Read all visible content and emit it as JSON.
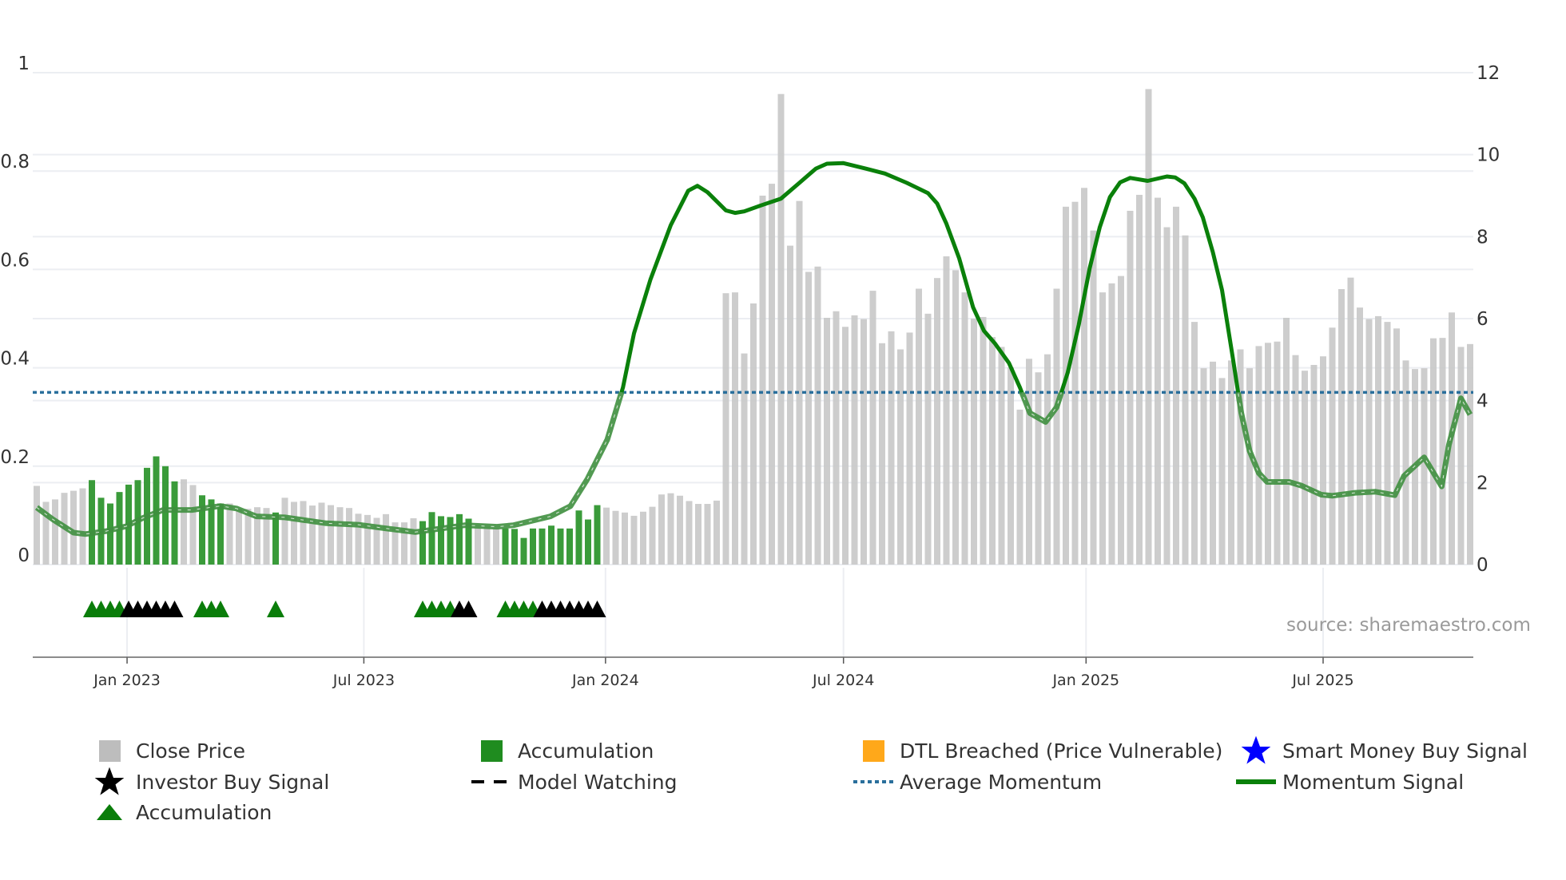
{
  "chart_data": {
    "type": "bar",
    "x_unit": "week index",
    "x_ticks": [
      {
        "label": "Jan 2023",
        "x": 9.83
      },
      {
        "label": "Jul 2023",
        "x": 35.6
      },
      {
        "label": "Jan 2024",
        "x": 61.9
      },
      {
        "label": "Jul 2024",
        "x": 87.8
      },
      {
        "label": "Jan 2025",
        "x": 114.2
      },
      {
        "label": "Jul 2025",
        "x": 140.0
      }
    ],
    "left_axis": {
      "ylim": [
        0,
        1
      ],
      "ticks": [
        "0",
        "0.2",
        "0.4",
        "0.6",
        "0.8",
        "1"
      ],
      "tick_values": [
        0,
        0.2,
        0.4,
        0.6,
        0.8,
        1
      ]
    },
    "right_axis": {
      "ylim": [
        0,
        12
      ],
      "ticks": [
        "0",
        "2",
        "4",
        "6",
        "8",
        "10",
        "12"
      ],
      "tick_values": [
        0,
        2,
        4,
        6,
        8,
        10,
        12
      ]
    },
    "close_price": [
      1.92,
      1.53,
      1.59,
      1.75,
      1.8,
      1.86,
      2.06,
      1.63,
      1.49,
      1.77,
      1.95,
      2.06,
      2.36,
      2.64,
      2.4,
      2.03,
      2.08,
      1.94,
      1.69,
      1.59,
      1.49,
      1.49,
      1.35,
      1.36,
      1.4,
      1.38,
      1.27,
      1.63,
      1.53,
      1.55,
      1.44,
      1.51,
      1.45,
      1.4,
      1.38,
      1.24,
      1.21,
      1.14,
      1.23,
      1.03,
      1.03,
      1.13,
      1.06,
      1.28,
      1.18,
      1.16,
      1.23,
      1.12,
      0.89,
      0.91,
      0.87,
      0.88,
      0.87,
      0.65,
      0.88,
      0.88,
      0.95,
      0.88,
      0.88,
      1.32,
      1.1,
      1.45,
      1.39,
      1.31,
      1.27,
      1.19,
      1.29,
      1.41,
      1.71,
      1.74,
      1.68,
      1.55,
      1.48,
      1.48,
      1.56,
      6.62,
      6.64,
      5.15,
      6.37,
      9.0,
      9.29,
      11.48,
      7.78,
      8.87,
      7.14,
      7.27,
      6.02,
      6.18,
      5.8,
      6.08,
      5.99,
      6.68,
      5.4,
      5.69,
      5.25,
      5.66,
      6.73,
      6.12,
      6.99,
      7.52,
      7.18,
      6.64,
      6.0,
      6.04,
      5.55,
      5.31,
      4.81,
      3.78,
      5.02,
      4.69,
      5.13,
      6.73,
      8.73,
      8.85,
      9.19,
      8.15,
      6.64,
      6.86,
      7.04,
      8.63,
      9.02,
      11.6,
      8.95,
      8.23,
      8.73,
      8.03,
      5.92,
      4.79,
      4.95,
      4.55,
      4.98,
      5.25,
      4.79,
      5.33,
      5.41,
      5.44,
      6.02,
      5.11,
      4.73,
      4.87,
      5.08,
      5.78,
      6.72,
      7.0,
      6.27,
      5.99,
      6.06,
      5.92,
      5.76,
      4.98,
      4.77,
      4.79,
      5.52,
      5.53,
      6.15,
      5.31,
      5.38
    ],
    "accumulation_weeks": [
      6,
      7,
      8,
      9,
      10,
      11,
      12,
      13,
      14,
      15,
      18,
      19,
      20,
      26,
      42,
      43,
      44,
      45,
      46,
      47,
      51,
      52,
      53,
      54,
      55,
      56,
      57,
      58,
      59,
      60,
      61
    ],
    "accumulation_triangle_weeks": [
      6,
      7,
      8,
      9,
      18,
      19,
      20,
      26,
      42,
      43,
      44,
      45,
      51,
      52,
      53,
      54
    ],
    "investor_buy_signal_weeks": [
      10,
      11,
      12,
      13,
      14,
      15,
      46,
      47,
      55,
      56,
      57,
      58,
      59,
      60,
      61
    ],
    "average_momentum": 0.35,
    "momentum_signal": [
      [
        0,
        0.116
      ],
      [
        1.74,
        0.092
      ],
      [
        4.0,
        0.065
      ],
      [
        5.3,
        0.062
      ],
      [
        7.57,
        0.068
      ],
      [
        9.74,
        0.078
      ],
      [
        11.57,
        0.095
      ],
      [
        13.74,
        0.111
      ],
      [
        16.87,
        0.111
      ],
      [
        20,
        0.119
      ],
      [
        21.74,
        0.114
      ],
      [
        23.9,
        0.098
      ],
      [
        27,
        0.096
      ],
      [
        31.5,
        0.084
      ],
      [
        35,
        0.081
      ],
      [
        38.2,
        0.073
      ],
      [
        41.2,
        0.066
      ],
      [
        43.9,
        0.073
      ],
      [
        46.6,
        0.08
      ],
      [
        50.1,
        0.077
      ],
      [
        51.9,
        0.08
      ],
      [
        55.9,
        0.098
      ],
      [
        58.1,
        0.119
      ],
      [
        59.9,
        0.173
      ],
      [
        62.1,
        0.254
      ],
      [
        63.8,
        0.36
      ],
      [
        65,
        0.47
      ],
      [
        66.8,
        0.58
      ],
      [
        69,
        0.69
      ],
      [
        70.9,
        0.76
      ],
      [
        71.9,
        0.77
      ],
      [
        73,
        0.757
      ],
      [
        75,
        0.72
      ],
      [
        76,
        0.715
      ],
      [
        77,
        0.718
      ],
      [
        78.8,
        0.73
      ],
      [
        81,
        0.744
      ],
      [
        83,
        0.776
      ],
      [
        84.8,
        0.805
      ],
      [
        86,
        0.815
      ],
      [
        87.8,
        0.816
      ],
      [
        90.2,
        0.805
      ],
      [
        92.3,
        0.795
      ],
      [
        94.7,
        0.776
      ],
      [
        97,
        0.755
      ],
      [
        98,
        0.734
      ],
      [
        99,
        0.693
      ],
      [
        100.4,
        0.622
      ],
      [
        101.9,
        0.523
      ],
      [
        103.1,
        0.475
      ],
      [
        104.3,
        0.449
      ],
      [
        105.8,
        0.41
      ],
      [
        107,
        0.36
      ],
      [
        108.1,
        0.308
      ],
      [
        109.8,
        0.29
      ],
      [
        111,
        0.32
      ],
      [
        112.2,
        0.39
      ],
      [
        113.4,
        0.487
      ],
      [
        114.6,
        0.603
      ],
      [
        115.7,
        0.686
      ],
      [
        116.8,
        0.747
      ],
      [
        117.9,
        0.777
      ],
      [
        119,
        0.786
      ],
      [
        120.9,
        0.78
      ],
      [
        123,
        0.789
      ],
      [
        123.9,
        0.787
      ],
      [
        124.9,
        0.775
      ],
      [
        126,
        0.744
      ],
      [
        126.9,
        0.706
      ],
      [
        128,
        0.635
      ],
      [
        129,
        0.558
      ],
      [
        130.2,
        0.417
      ],
      [
        131.1,
        0.308
      ],
      [
        132,
        0.231
      ],
      [
        133,
        0.186
      ],
      [
        133.9,
        0.168
      ],
      [
        136.3,
        0.168
      ],
      [
        137.7,
        0.16
      ],
      [
        139.8,
        0.142
      ],
      [
        141,
        0.14
      ],
      [
        143.5,
        0.146
      ],
      [
        145.7,
        0.148
      ],
      [
        147.8,
        0.141
      ],
      [
        148.8,
        0.18
      ],
      [
        151,
        0.218
      ],
      [
        152.9,
        0.159
      ],
      [
        153.7,
        0.244
      ],
      [
        155,
        0.338
      ],
      [
        156,
        0.305
      ]
    ],
    "colors": {
      "close_price": "#c8c8c8",
      "accumulation": "#2f962f",
      "dtl": "#ffa81a",
      "smart_money": "#0000ff",
      "investor": "#000000",
      "avg_momentum": "#2a6f9c",
      "momentum": "#0a800a",
      "triangle": "#0a7d0a"
    },
    "source": "source: sharemaestro.com",
    "legend": [
      {
        "label": "Close Price",
        "icon": "gray-square"
      },
      {
        "label": "Accumulation",
        "icon": "green-square"
      },
      {
        "label": "DTL Breached (Price Vulnerable)",
        "icon": "orange-square"
      },
      {
        "label": "Smart Money Buy Signal",
        "icon": "blue-star"
      },
      {
        "label": "Investor Buy Signal",
        "icon": "black-star"
      },
      {
        "label": "Model Watching",
        "icon": "black-dashed-line"
      },
      {
        "label": "Average Momentum",
        "icon": "blue-dotted-line"
      },
      {
        "label": "Momentum Signal",
        "icon": "green-line"
      },
      {
        "label": "Accumulation",
        "icon": "green-triangle"
      }
    ]
  }
}
